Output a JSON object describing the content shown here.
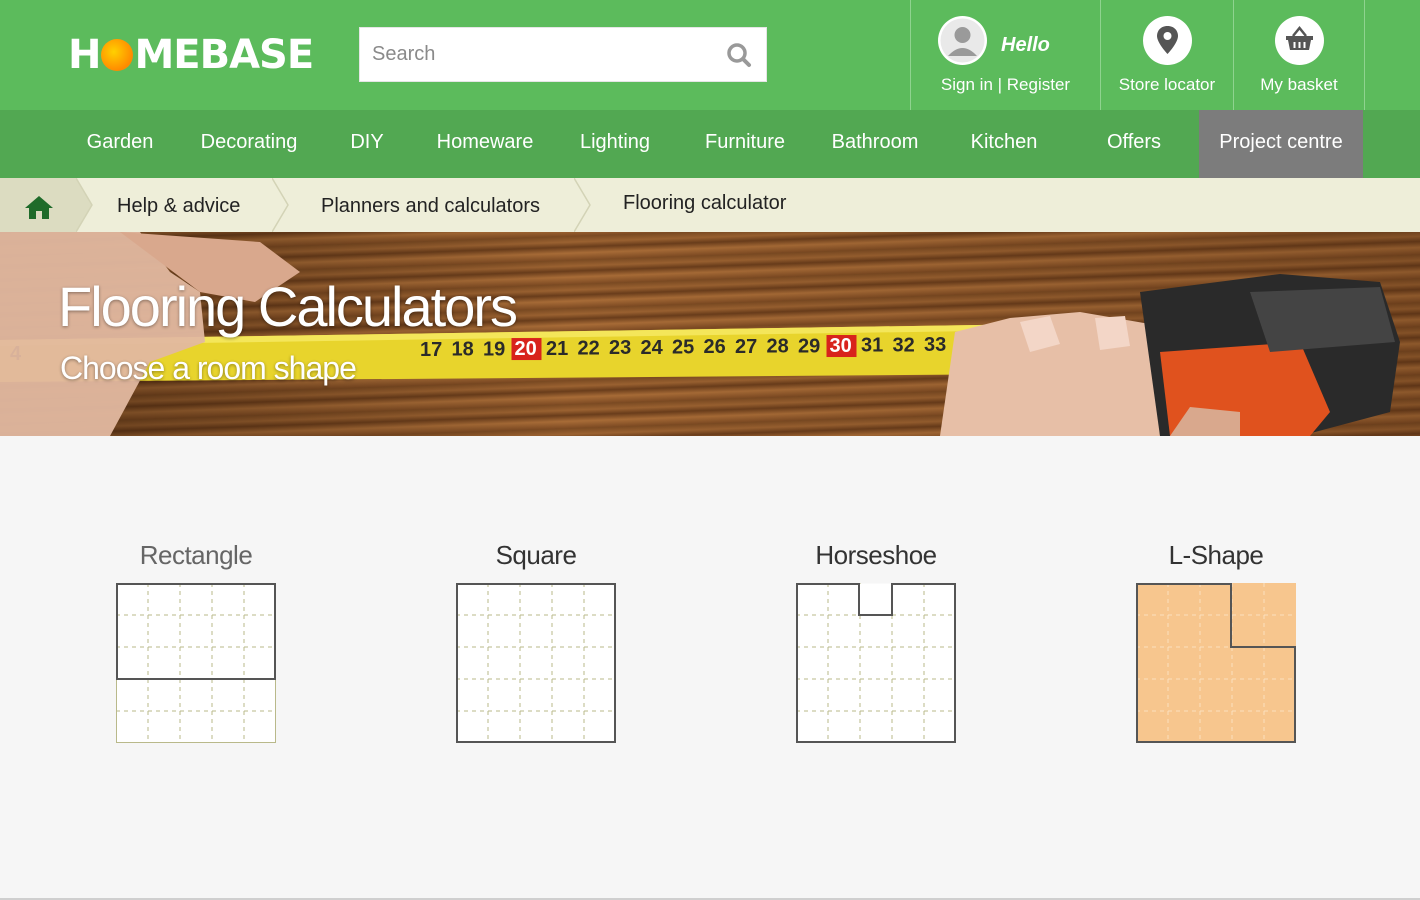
{
  "brand": {
    "logo_text_left": "H",
    "logo_text_right": "MEBASE"
  },
  "search": {
    "placeholder": "Search"
  },
  "account": {
    "greeting": "Hello",
    "link": "Sign in | Register"
  },
  "store_locator": {
    "label": "Store locator"
  },
  "basket": {
    "label": "My basket"
  },
  "nav": [
    {
      "label": "Garden"
    },
    {
      "label": "Decorating"
    },
    {
      "label": "DIY"
    },
    {
      "label": "Homeware"
    },
    {
      "label": "Lighting"
    },
    {
      "label": "Furniture"
    },
    {
      "label": "Bathroom"
    },
    {
      "label": "Kitchen"
    },
    {
      "label": "Offers"
    },
    {
      "label": "Project centre",
      "active": true
    }
  ],
  "breadcrumb": [
    {
      "label": "Help & advice"
    },
    {
      "label": "Planners and calculators"
    },
    {
      "label": "Flooring calculator"
    }
  ],
  "hero": {
    "title": "Flooring Calculators",
    "subtitle": "Choose a room shape",
    "tape_numbers": [
      "4",
      "17",
      "18",
      "19",
      "20",
      "21",
      "22",
      "23",
      "24",
      "25",
      "26",
      "27",
      "28",
      "29",
      "30",
      "31",
      "32",
      "33"
    ]
  },
  "shapes": [
    {
      "label": "Rectangle",
      "selected": false
    },
    {
      "label": "Square",
      "selected": false
    },
    {
      "label": "Horseshoe",
      "selected": false
    },
    {
      "label": "L-Shape",
      "selected": true
    }
  ],
  "colors": {
    "header_green": "#5cbb5c",
    "nav_green": "#52a852",
    "nav_active": "#7c7c7c",
    "breadcrumb_bg": "#eeeed9",
    "shape_fill_selected": "#f7c68e",
    "grid_dash": "#b9b98a"
  },
  "icons": [
    "search-icon",
    "user-icon",
    "map-pin-icon",
    "basket-icon",
    "home-icon"
  ]
}
